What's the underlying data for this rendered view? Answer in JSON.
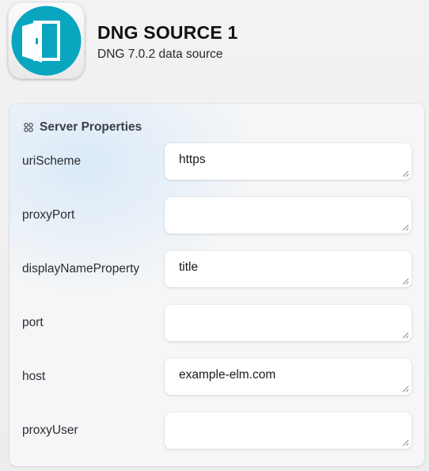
{
  "app": {
    "title": "DNG SOURCE 1",
    "subtitle": "DNG 7.0.2 data source",
    "icon": "open-door-icon",
    "icon_color": "#0aa5bf"
  },
  "section": {
    "title": "Server Properties",
    "icon": "grid-icon"
  },
  "fields": [
    {
      "label": "uriScheme",
      "value": "https"
    },
    {
      "label": "proxyPort",
      "value": ""
    },
    {
      "label": "displayNameProperty",
      "value": "title"
    },
    {
      "label": "port",
      "value": ""
    },
    {
      "label": "host",
      "value": "example-elm.com"
    },
    {
      "label": "proxyUser",
      "value": ""
    }
  ]
}
